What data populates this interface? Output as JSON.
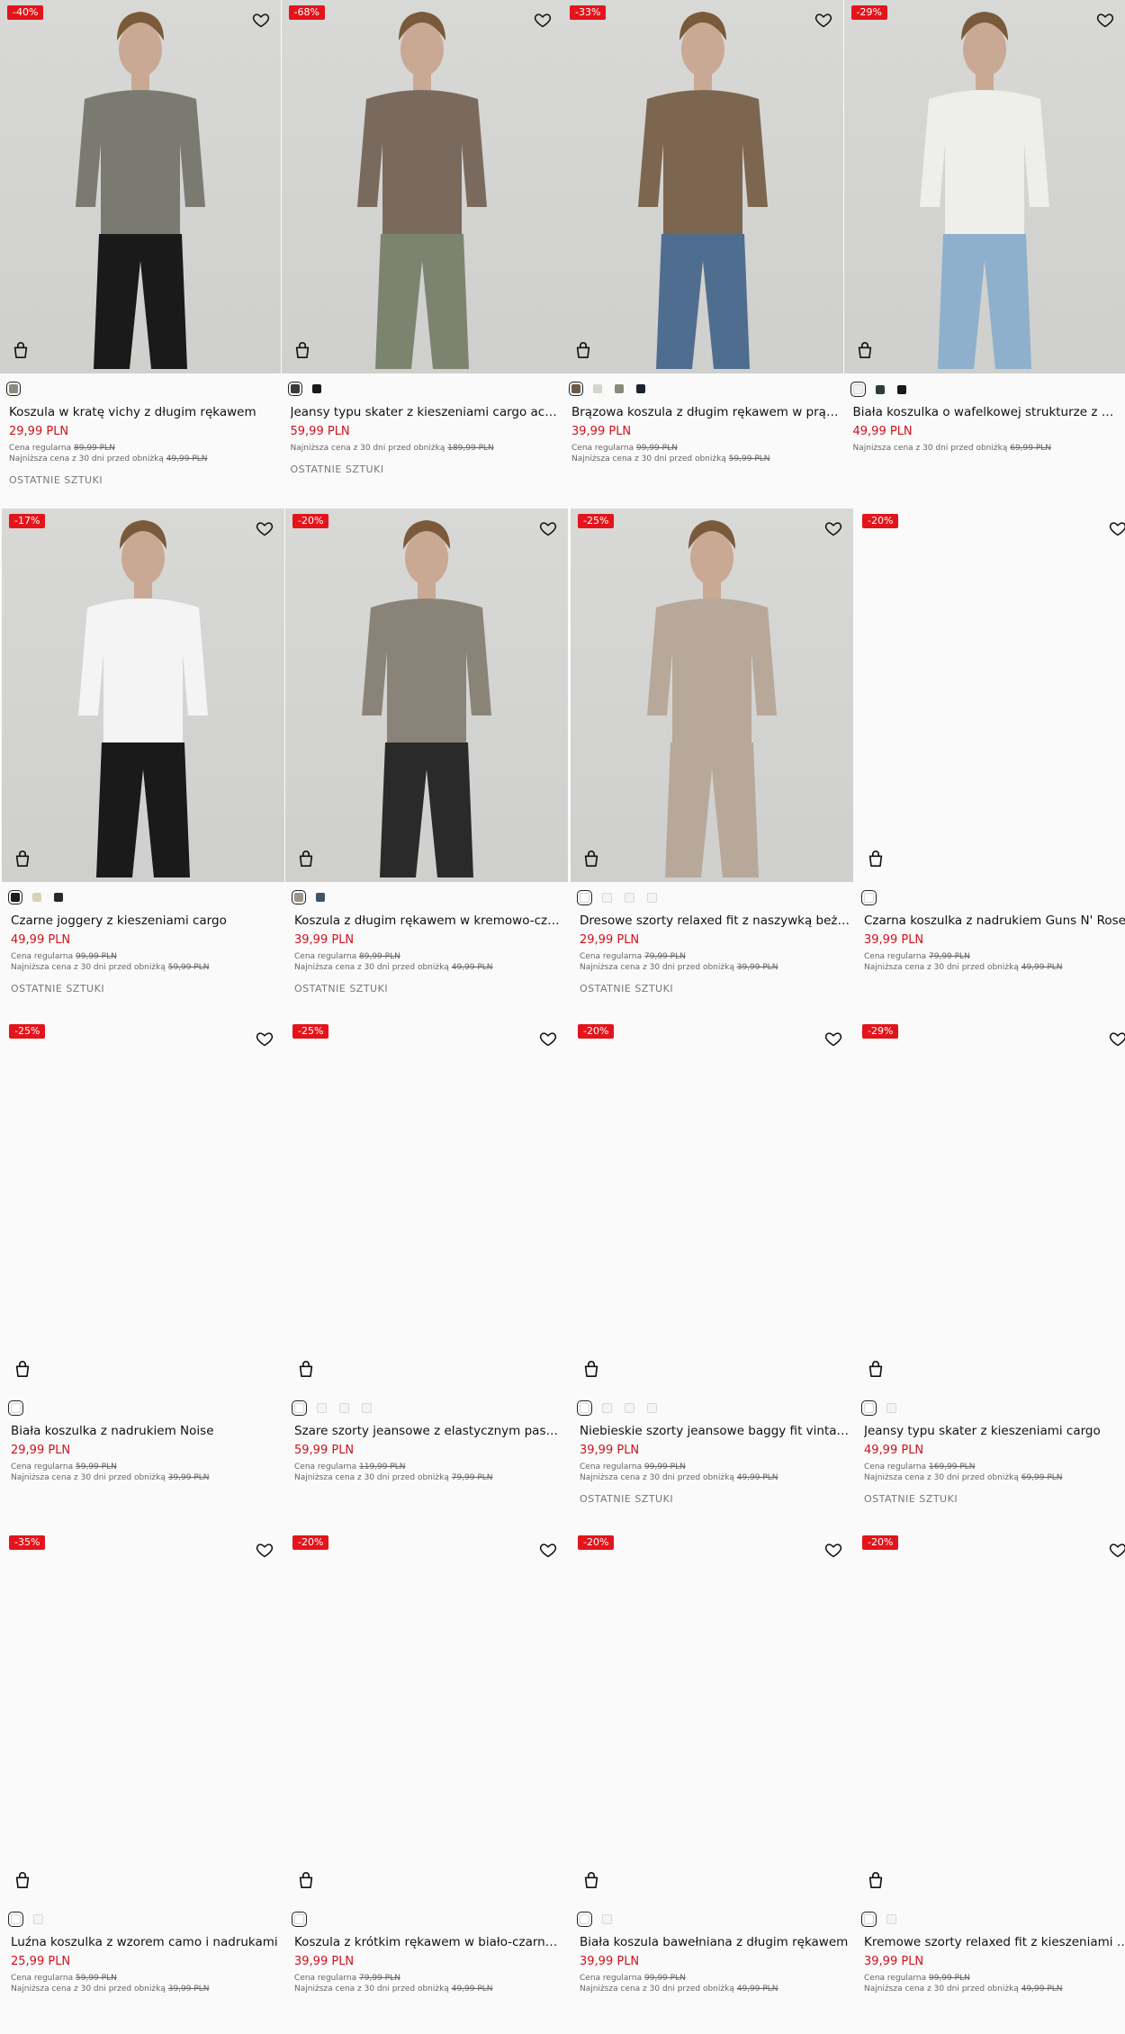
{
  "labels": {
    "regular_prefix": "Cena regularna",
    "lowest_prefix": "Najniższa cena z 30 dni przed obniżką",
    "last_items": "OSTATNIE SZTUKI"
  },
  "products": [
    {
      "badge": "-40%",
      "title": "Koszula w kratę vichy z długim rękawem",
      "price": "29,99 PLN",
      "regular": "89,99 PLN",
      "lowest": "49,99 PLN",
      "last": true,
      "swatches": [
        "#8c8a82"
      ],
      "image": true,
      "shirt": "#7a7a70",
      "pants": "#1a1a1a"
    },
    {
      "badge": "-68%",
      "title": "Jeansy typu skater z kieszeniami cargo acid …",
      "price": "59,99 PLN",
      "regular": null,
      "lowest": "189,99 PLN",
      "last": true,
      "swatches": [
        "#3a3a3a",
        "#1a1a1a"
      ],
      "image": true,
      "shirt": "#7a6a5e",
      "pants": "#7c8470"
    },
    {
      "badge": "-33%",
      "title": "Brązowa koszula z długim rękawem w prążki",
      "price": "39,99 PLN",
      "regular": "99,99 PLN",
      "lowest": "59,99 PLN",
      "last": false,
      "swatches": [
        "#6d5a48",
        "#d5d5d0",
        "#8a8a7a",
        "#1d2330"
      ],
      "image": true,
      "shirt": "#7d6650",
      "pants": "#4f6d8f"
    },
    {
      "badge": "-29%",
      "title": "Biała koszulka o wafelkowej strukturze z haft…",
      "price": "49,99 PLN",
      "regular": null,
      "lowest": "69,99 PLN",
      "last": false,
      "swatches": [
        "#f0f0ee",
        "#2d3e36",
        "#1a1a1a"
      ],
      "image": true,
      "shirt": "#eeeeea",
      "pants": "#8fb0cc"
    },
    {
      "badge": "-17%",
      "title": "Czarne joggery z kieszeniami cargo",
      "price": "49,99 PLN",
      "regular": "99,99 PLN",
      "lowest": "59,99 PLN",
      "last": true,
      "swatches": [
        "#1a1a1a",
        "#d9d2b5",
        "#2a2a2a"
      ],
      "image": true,
      "shirt": "#f4f4f4",
      "pants": "#1a1a1a"
    },
    {
      "badge": "-20%",
      "title": "Koszula z długim rękawem w kremowo-czar…",
      "price": "39,99 PLN",
      "regular": "89,99 PLN",
      "lowest": "49,99 PLN",
      "last": true,
      "swatches": [
        "#9a948a",
        "#3d5568"
      ],
      "image": true,
      "shirt": "#8a8478",
      "pants": "#2a2a2a"
    },
    {
      "badge": "-25%",
      "title": "Dresowe szorty relaxed fit z naszywką beżo…",
      "price": "29,99 PLN",
      "regular": "79,99 PLN",
      "lowest": "39,99 PLN",
      "last": true,
      "swatches": [
        "#ffffff",
        "#f4f4f4",
        "#f4f4f4",
        "#f4f4f4"
      ],
      "image": true,
      "shirt": "#b7a89a",
      "pants": "#b7a89a"
    },
    {
      "badge": "-20%",
      "title": "Czarna koszulka z nadrukiem Guns N' Roses",
      "price": "39,99 PLN",
      "regular": "79,99 PLN",
      "lowest": "49,99 PLN",
      "last": false,
      "swatches": [
        "#ffffff"
      ],
      "image": false
    },
    {
      "badge": "-25%",
      "title": "Biała koszulka z nadrukiem Noise",
      "price": "29,99 PLN",
      "regular": "59,99 PLN",
      "lowest": "39,99 PLN",
      "last": false,
      "swatches": [
        "#ffffff"
      ],
      "image": false
    },
    {
      "badge": "-25%",
      "title": "Szare szorty jeansowe z elastycznym pasem",
      "price": "59,99 PLN",
      "regular": "119,99 PLN",
      "lowest": "79,99 PLN",
      "last": false,
      "swatches": [
        "#ffffff",
        "#f4f4f4",
        "#f4f4f4",
        "#f4f4f4"
      ],
      "image": false
    },
    {
      "badge": "-20%",
      "title": "Niebieskie szorty jeansowe baggy fit vintage",
      "price": "39,99 PLN",
      "regular": "99,99 PLN",
      "lowest": "49,99 PLN",
      "last": true,
      "swatches": [
        "#ffffff",
        "#f4f4f4",
        "#f4f4f4",
        "#f4f4f4"
      ],
      "image": false
    },
    {
      "badge": "-29%",
      "title": "Jeansy typu skater z kieszeniami cargo",
      "price": "49,99 PLN",
      "regular": "169,99 PLN",
      "lowest": "69,99 PLN",
      "last": true,
      "swatches": [
        "#ffffff",
        "#f4f4f4"
      ],
      "image": false
    },
    {
      "badge": "-35%",
      "title": "Luźna koszulka z wzorem camo i nadrukami",
      "price": "25,99 PLN",
      "regular": "59,99 PLN",
      "lowest": "39,99 PLN",
      "last": false,
      "swatches": [
        "#ffffff",
        "#f4f4f4"
      ],
      "image": false
    },
    {
      "badge": "-20%",
      "title": "Koszula z krótkim rękawem w biało-czarną d…",
      "price": "39,99 PLN",
      "regular": "79,99 PLN",
      "lowest": "49,99 PLN",
      "last": false,
      "swatches": [
        "#ffffff"
      ],
      "image": false
    },
    {
      "badge": "-20%",
      "title": "Biała koszula bawełniana z długim rękawem",
      "price": "39,99 PLN",
      "regular": "99,99 PLN",
      "lowest": "49,99 PLN",
      "last": false,
      "swatches": [
        "#ffffff",
        "#f4f4f4"
      ],
      "image": false
    },
    {
      "badge": "-20%",
      "title": "Kremowe szorty relaxed fit z kieszeniami car…",
      "price": "39,99 PLN",
      "regular": "99,99 PLN",
      "lowest": "49,99 PLN",
      "last": false,
      "swatches": [
        "#ffffff",
        "#f4f4f4"
      ],
      "image": false
    }
  ]
}
